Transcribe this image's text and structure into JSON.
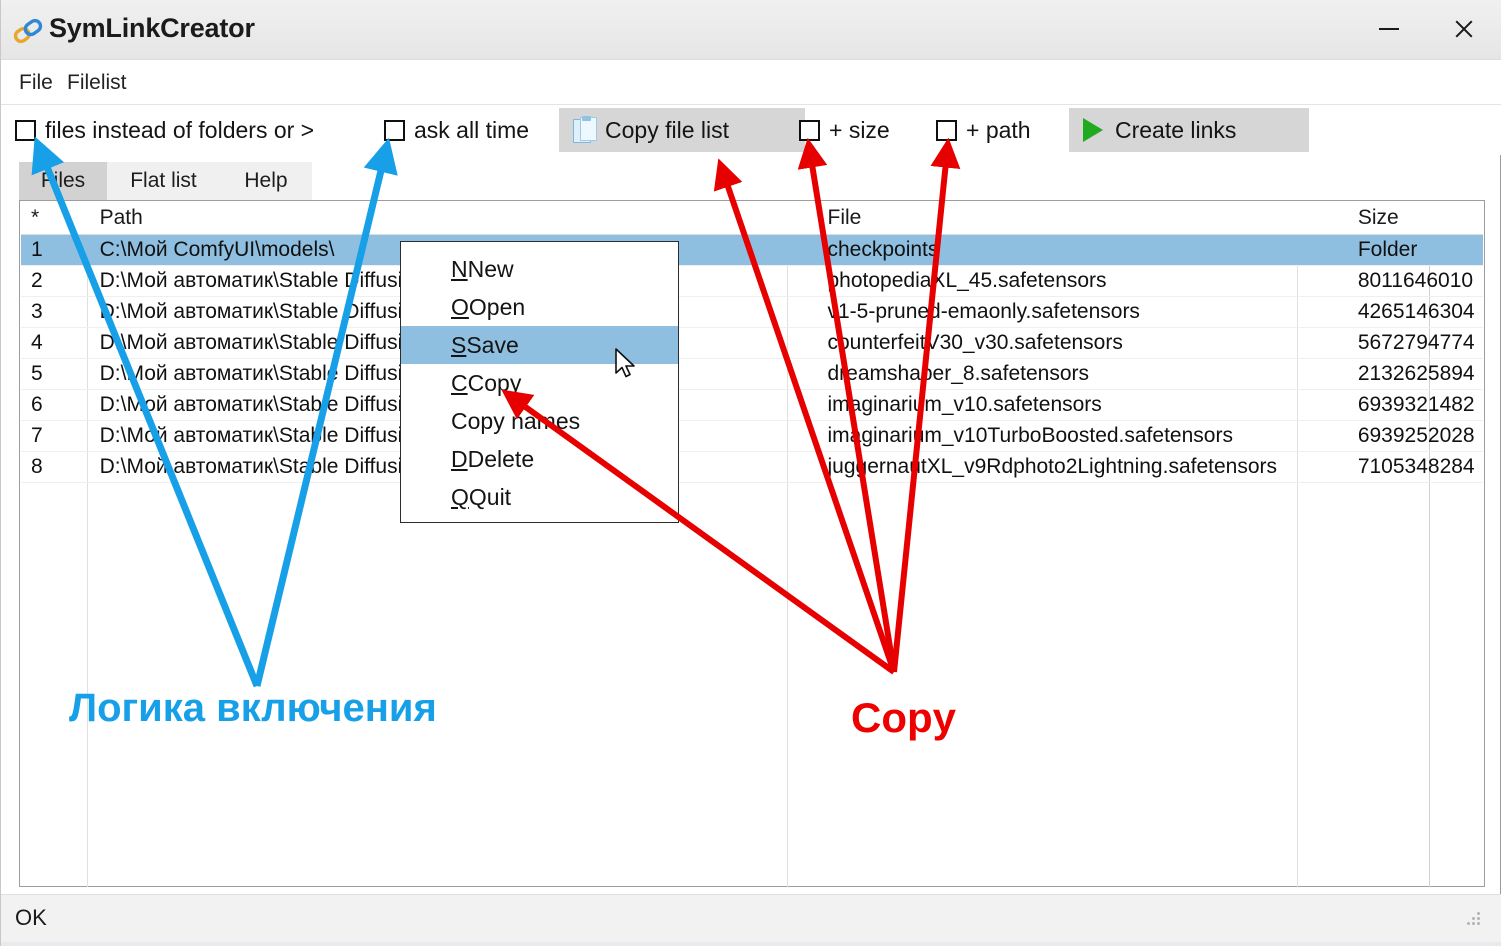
{
  "window": {
    "title": "SymLinkCreator",
    "icon": "chain-link-icon",
    "minimize_label": "–",
    "close_label": "✕"
  },
  "menubar": {
    "items": [
      {
        "label": "File"
      },
      {
        "label": "Filelist"
      }
    ]
  },
  "toolbar": {
    "files_instead_of_folders": {
      "label": "files instead of folders or >",
      "checked": false
    },
    "ask_all_time": {
      "label": "ask all time",
      "checked": false
    },
    "copy_file_list": {
      "label": "Copy file list",
      "icon": "clipboard-icon"
    },
    "plus_size": {
      "label": "+ size",
      "checked": false
    },
    "plus_path": {
      "label": "+ path",
      "checked": false
    },
    "create_links": {
      "label": "Create links",
      "icon": "play-icon"
    }
  },
  "tabs": [
    {
      "label": "Files",
      "active": true
    },
    {
      "label": "Flat list",
      "active": false
    },
    {
      "label": "Help",
      "active": false
    }
  ],
  "table": {
    "headers": [
      "*",
      "Path",
      "File",
      "Size"
    ],
    "rows": [
      {
        "idx": "1",
        "path": "C:\\Мой ComfyUI\\models\\",
        "file": "checkpoints",
        "size": "Folder",
        "selected": true
      },
      {
        "idx": "2",
        "path": "D:\\Мой автоматик\\Stable Diffusion\\",
        "file": "photopediaXL_45.safetensors",
        "size": "8011646010",
        "selected": false
      },
      {
        "idx": "3",
        "path": "D:\\Мой автоматик\\Stable Diffusion\\",
        "file": "v1-5-pruned-emaonly.safetensors",
        "size": "4265146304",
        "selected": false
      },
      {
        "idx": "4",
        "path": "D:\\Мой автоматик\\Stable Diffusion\\",
        "file": "counterfeitV30_v30.safetensors",
        "size": "5672794774",
        "selected": false
      },
      {
        "idx": "5",
        "path": "D:\\Мой автоматик\\Stable Diffusion\\",
        "file": "dreamshaper_8.safetensors",
        "size": "2132625894",
        "selected": false
      },
      {
        "idx": "6",
        "path": "D:\\Мой автоматик\\Stable Diffusion\\",
        "file": "imaginarium_v10.safetensors",
        "size": "6939321482",
        "selected": false
      },
      {
        "idx": "7",
        "path": "D:\\Мой автоматик\\Stable Diffusion\\",
        "file": "imaginarium_v10TurboBoosted.safetensors",
        "size": "6939252028",
        "selected": false
      },
      {
        "idx": "8",
        "path": "D:\\Мой автоматик\\Stable Diffusion\\",
        "file": "juggernautXL_v9Rdphoto2Lightning.safetensors",
        "size": "7105348284",
        "selected": false
      }
    ]
  },
  "context_menu": {
    "items": [
      {
        "label": "New",
        "mnemonic": "N",
        "highlighted": false
      },
      {
        "label": "Open",
        "mnemonic": "O",
        "highlighted": false
      },
      {
        "label": "Save",
        "mnemonic": "S",
        "highlighted": true
      },
      {
        "label": "Copy",
        "mnemonic": "C",
        "highlighted": false
      },
      {
        "label": "Copy names",
        "mnemonic": "p",
        "highlighted": false
      },
      {
        "label": "Delete",
        "mnemonic": "D",
        "highlighted": false
      },
      {
        "label": "Quit",
        "mnemonic": "Q",
        "highlighted": false
      }
    ]
  },
  "annotations": {
    "blue_label": "Логика включения",
    "red_label": "Copy",
    "blue_color": "#17a0e8",
    "red_color": "#ee0000"
  },
  "statusbar": {
    "text": "OK"
  },
  "colors": {
    "selection": "#8fbfe0",
    "toolbar_button": "#d6d6d6",
    "tab_active": "#d2d2d2",
    "play_green": "#1faa1f"
  }
}
